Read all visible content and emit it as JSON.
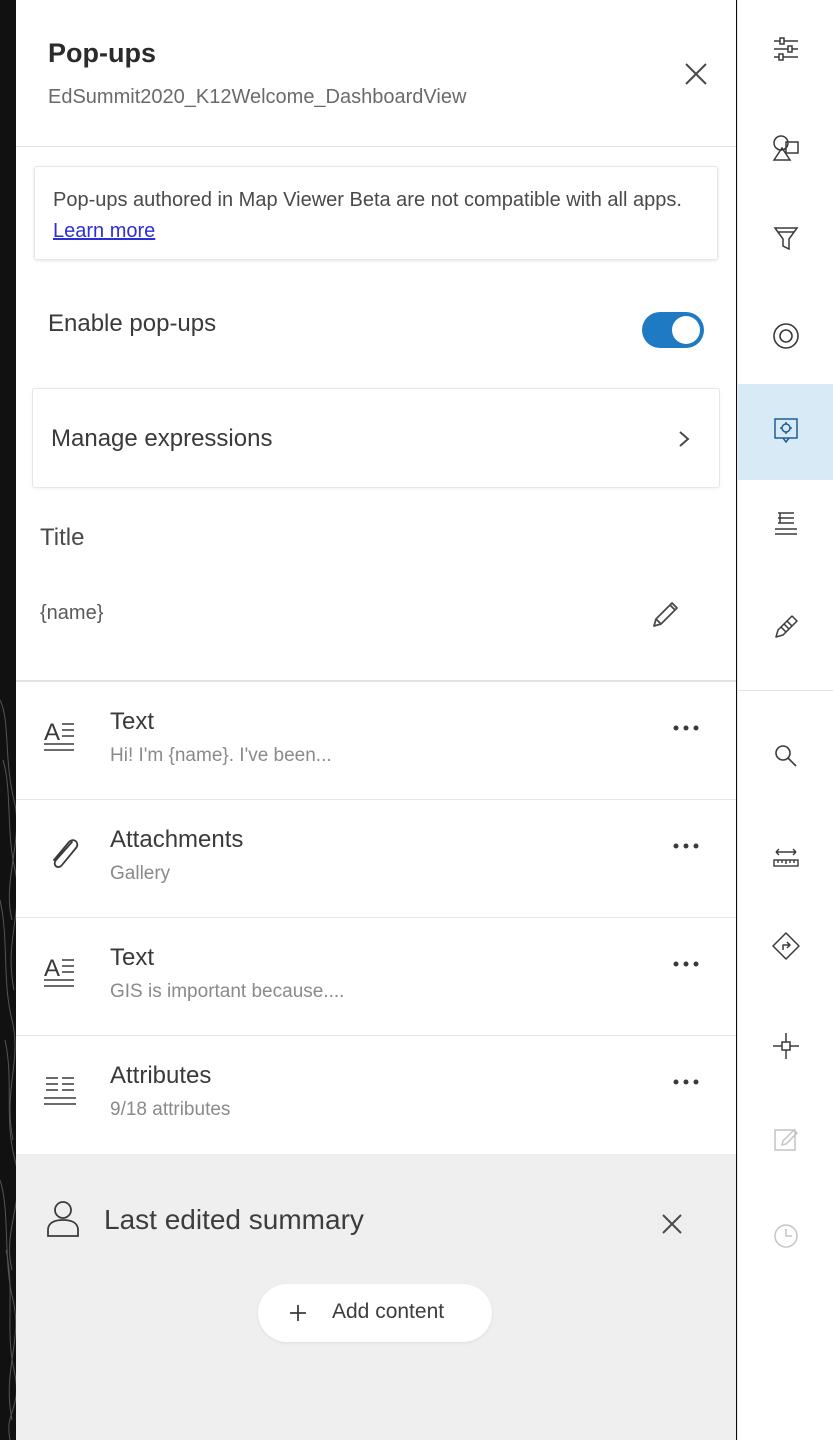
{
  "header": {
    "title": "Pop-ups",
    "subtitle": "EdSummit2020_K12Welcome_DashboardView"
  },
  "notice": {
    "text": "Pop-ups authored in Map Viewer Beta are not compatible with all apps. ",
    "link": "Learn more"
  },
  "enable": {
    "label": "Enable pop-ups",
    "state": "on"
  },
  "manage": {
    "label": "Manage expressions"
  },
  "title_section": {
    "label": "Title",
    "value": "{name}"
  },
  "content_items": [
    {
      "name": "Text",
      "desc": "Hi! I'm {name}. I've been...",
      "icon": "text-icon"
    },
    {
      "name": "Attachments",
      "desc": "Gallery",
      "icon": "paperclip-icon"
    },
    {
      "name": "Text",
      "desc": "GIS is important because....",
      "icon": "text-icon"
    },
    {
      "name": "Attributes",
      "desc": "9/18 attributes",
      "icon": "attributes-list-icon"
    }
  ],
  "summary": {
    "label": "Last edited summary",
    "add_label": "Add content"
  },
  "rail": {
    "items": [
      "properties-icon",
      "styles-icon",
      "filter-icon",
      "effects-icon",
      "popups-icon",
      "fields-icon",
      "sketch-icon",
      "search-icon",
      "measure-icon",
      "directions-icon",
      "location-icon",
      "edit-icon",
      "time-icon"
    ],
    "active": "popups-icon"
  },
  "colors": {
    "accent": "#1f7ac4",
    "active_bg": "#d9eaf7",
    "link": "#2e2ed8"
  }
}
